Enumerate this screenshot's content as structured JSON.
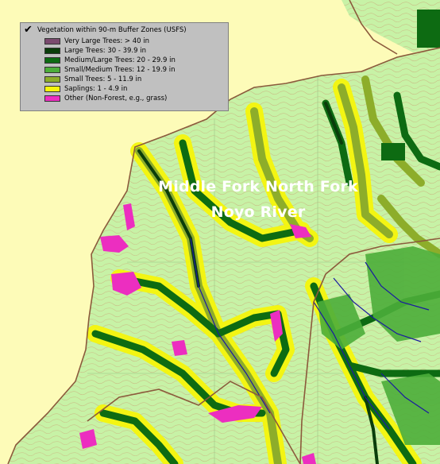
{
  "legend": {
    "title": "Vegetation within 90-m Buffer Zones (USFS)",
    "checked": true,
    "items": [
      {
        "label": "Very Large Trees: > 40  in",
        "color": "#7a4a6e"
      },
      {
        "label": "Large Trees: 30 - 39.9 in",
        "color": "#0a3d0a"
      },
      {
        "label": "Medium/Large Trees: 20 - 29.9 in",
        "color": "#0d6b12"
      },
      {
        "label": "Small/Medium Trees: 12 - 19.9 in",
        "color": "#4cae3a"
      },
      {
        "label": "Small Trees: 5 - 11.9 in",
        "color": "#8dad2a"
      },
      {
        "label": "Saplings: 1 - 4.9 in",
        "color": "#f6f60c"
      },
      {
        "label": "Other (Non-Forest, e.g., grass)",
        "color": "#ec2ec0"
      }
    ]
  },
  "map": {
    "label_line1": "Middle Fork North Fork",
    "label_line2": "Noyo River",
    "colors": {
      "outside": "#fdfbb8",
      "terrain": "#c7f2a6",
      "contour": "#b89a68",
      "boundary": "#8b5a3c",
      "stream": "#1a1aa0"
    }
  }
}
